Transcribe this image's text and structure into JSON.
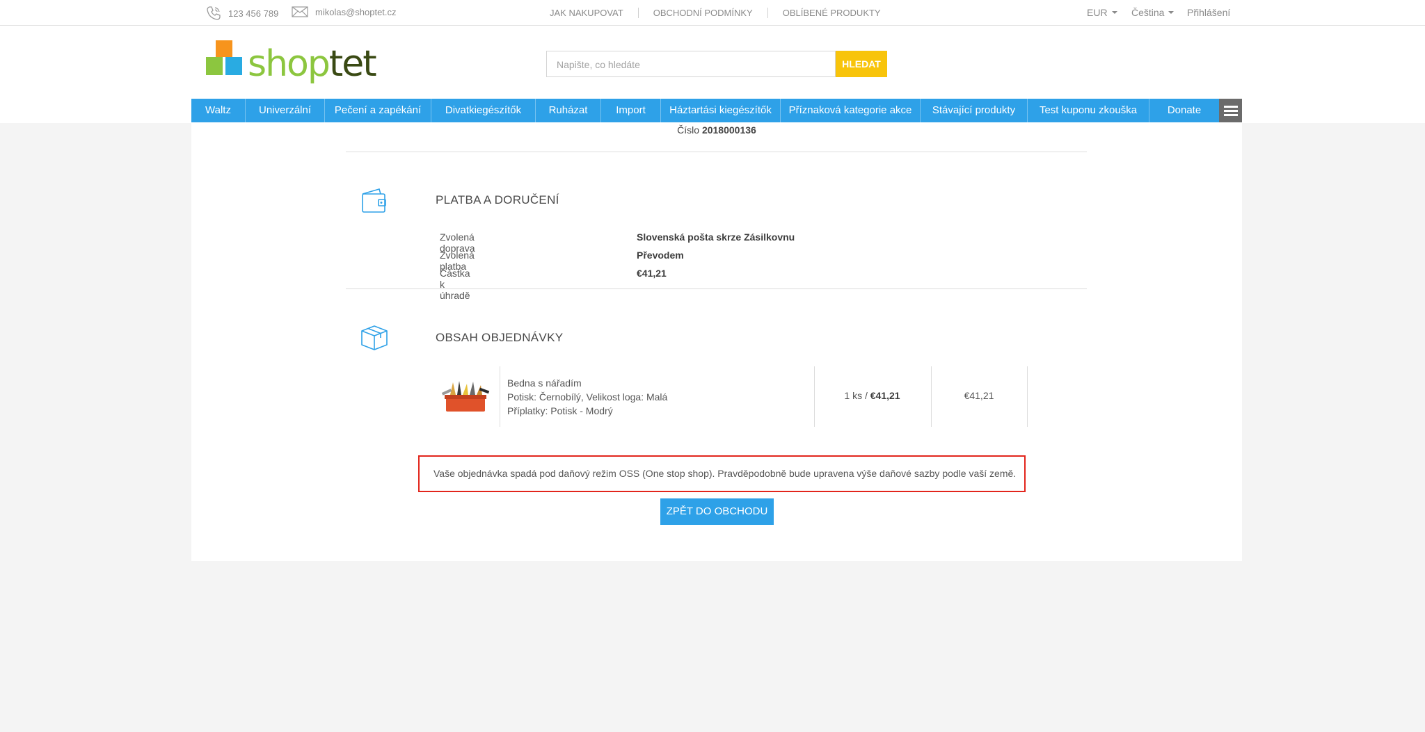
{
  "topbar": {
    "phone": "123 456 789",
    "email": "mikolas@shoptet.cz",
    "links": [
      "JAK NAKUPOVAT",
      "OBCHODNÍ PODMÍNKY",
      "OBLÍBENÉ PRODUKTY"
    ],
    "currency": "EUR",
    "language": "Čeština",
    "login": "Přihlášení"
  },
  "header": {
    "logo_text_shop": "shop",
    "logo_text_tet": "tet",
    "search_placeholder": "Napište, co hledáte",
    "search_button": "HLEDAT"
  },
  "nav": {
    "items": [
      "Waltz",
      "Univerzální",
      "Pečení a zapékání",
      "Divatkiegészítők",
      "Ruházat",
      "Import",
      "Háztartási kiegészítők",
      "Příznaková kategorie akce",
      "Stávající produkty",
      "Test kuponu zkouška",
      "Donate"
    ]
  },
  "order": {
    "number_label": "Číslo",
    "number": "2018000136"
  },
  "payment_section": {
    "title": "PLATBA A DORUČENÍ",
    "rows": [
      {
        "label": "Zvolená doprava",
        "value": "Slovenská pošta skrze Zásilkovnu"
      },
      {
        "label": "Zvolená platba",
        "value": "Převodem"
      },
      {
        "label": "Částka k úhradě",
        "value": "€41,21"
      }
    ]
  },
  "content_section": {
    "title": "OBSAH OBJEDNÁVKY",
    "item": {
      "name": "Bedna s nářadím",
      "variant": "Potisk: Černobílý, Velikost loga: Malá",
      "surcharge": "Příplatky: Potisk - Modrý",
      "qty_text": "1 ks /",
      "unit_price": "€41,21",
      "total": "€41,21"
    }
  },
  "notice": "Vaše objednávka spadá pod daňový režim OSS (One stop shop). Pravděpodobně bude upravena výše daňové sazby podle vaší země.",
  "back_button": "ZPĚT DO OBCHODU",
  "colors": {
    "accent": "#2ea1e8",
    "search_button": "#f8c40b",
    "notice_border": "#e2251c",
    "logo_orange": "#f7941d",
    "logo_green": "#8cc63f",
    "logo_blue": "#29abe2"
  }
}
